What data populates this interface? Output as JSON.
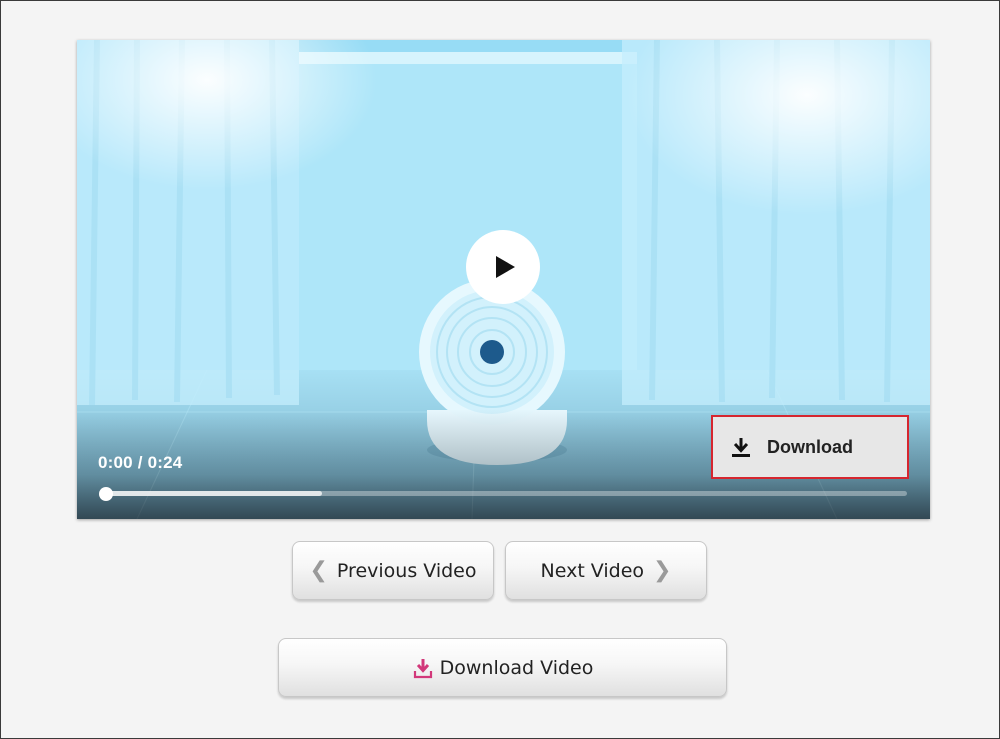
{
  "player": {
    "time_display": "0:00 / 0:24",
    "progress_fraction": 0.0,
    "buffered_fraction": 0.27,
    "overlay_download_label": "Download",
    "play_icon": "play-icon",
    "download_icon": "download-icon"
  },
  "controls": {
    "previous_label": "Previous Video",
    "next_label": "Next Video",
    "download_video_label": "Download Video"
  },
  "colors": {
    "highlight_border": "#d6262f",
    "download_icon_accent": "#d2387a"
  }
}
